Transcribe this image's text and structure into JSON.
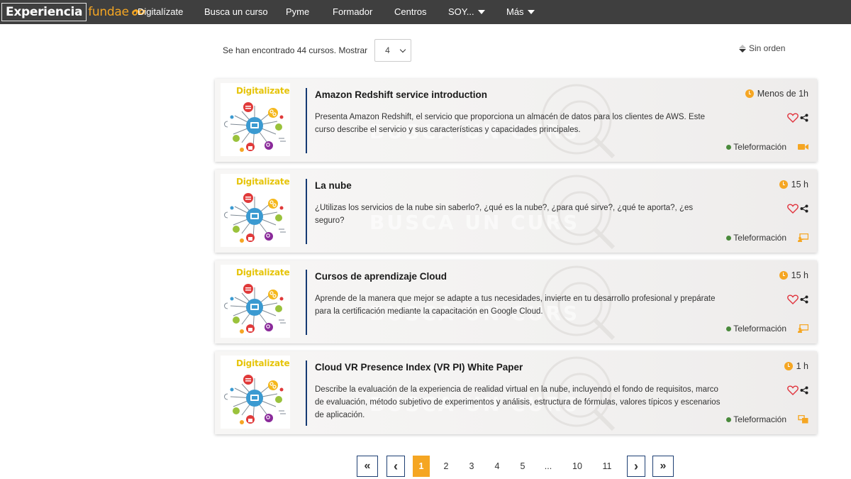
{
  "nav": {
    "logo_strong": "Experiencia",
    "logo_light": "fundae",
    "items": [
      {
        "label": "Digitalízate",
        "dropdown": false
      },
      {
        "label": "Busca un curso",
        "dropdown": false
      },
      {
        "label": "Pyme",
        "dropdown": false
      },
      {
        "label": "Formador",
        "dropdown": false
      },
      {
        "label": "Centros",
        "dropdown": false
      },
      {
        "label": "SOY...",
        "dropdown": true
      },
      {
        "label": "Más",
        "dropdown": true
      }
    ]
  },
  "results": {
    "summary": "Se han encontrado 44 cursos. Mostrar",
    "show_value": "4",
    "sort_label": "Sin orden"
  },
  "cards": [
    {
      "thumb_label": "Digitalizate",
      "title": "Amazon Redshift service introduction",
      "description": "Presenta Amazon Redshift, el servicio que proporciona un almacén de datos para los clientes de AWS. Este curso describe el servicio y sus características y capacidades principales.",
      "duration": "Menos de 1h",
      "modality": "Teleformación",
      "modality_icon": "video-camera-icon"
    },
    {
      "thumb_label": "Digitalizate",
      "title": "La nube",
      "description": "¿Utilizas los servicios de la nube sin saberlo?, ¿qué es la nube?, ¿para qué sirve?, ¿qué te aporta?, ¿es seguro?",
      "duration": "15 h",
      "modality": "Teleformación",
      "modality_icon": "presentation-icon"
    },
    {
      "thumb_label": "Digitalizate",
      "title": "Cursos de aprendizaje Cloud",
      "description": "Aprende de la manera que mejor se adapte a tus necesidades, invierte en tu desarrollo profesional y prepárate para la certificación mediante la capacitación en Google Cloud.",
      "duration": "15 h",
      "modality": "Teleformación",
      "modality_icon": "presentation-icon"
    },
    {
      "thumb_label": "Digitalizate",
      "title": "Cloud VR Presence Index (VR PI) White Paper",
      "description": "Describe la evaluación de la experiencia de realidad virtual en la nube, incluyendo el fondo de requisitos, marco de evaluación, método subjetivo de experimentos y análisis, estructura de fórmulas, valores típicos y escenarios de aplicación.",
      "duration": "1 h",
      "modality": "Teleformación",
      "modality_icon": "documents-icon"
    }
  ],
  "watermark_text": "BUSCA UN CURS",
  "pagination": {
    "first": "«",
    "prev": "‹",
    "pages": [
      "1",
      "2",
      "3",
      "4",
      "5",
      "...",
      "10",
      "11"
    ],
    "current": "1",
    "next": "›",
    "last": "»"
  },
  "colors": {
    "nav_bg": "#3f3f3f",
    "accent_orange": "#f5a623",
    "separator_blue": "#153a73",
    "heart_red": "#e0323c",
    "online_green": "#4a8a3c"
  }
}
